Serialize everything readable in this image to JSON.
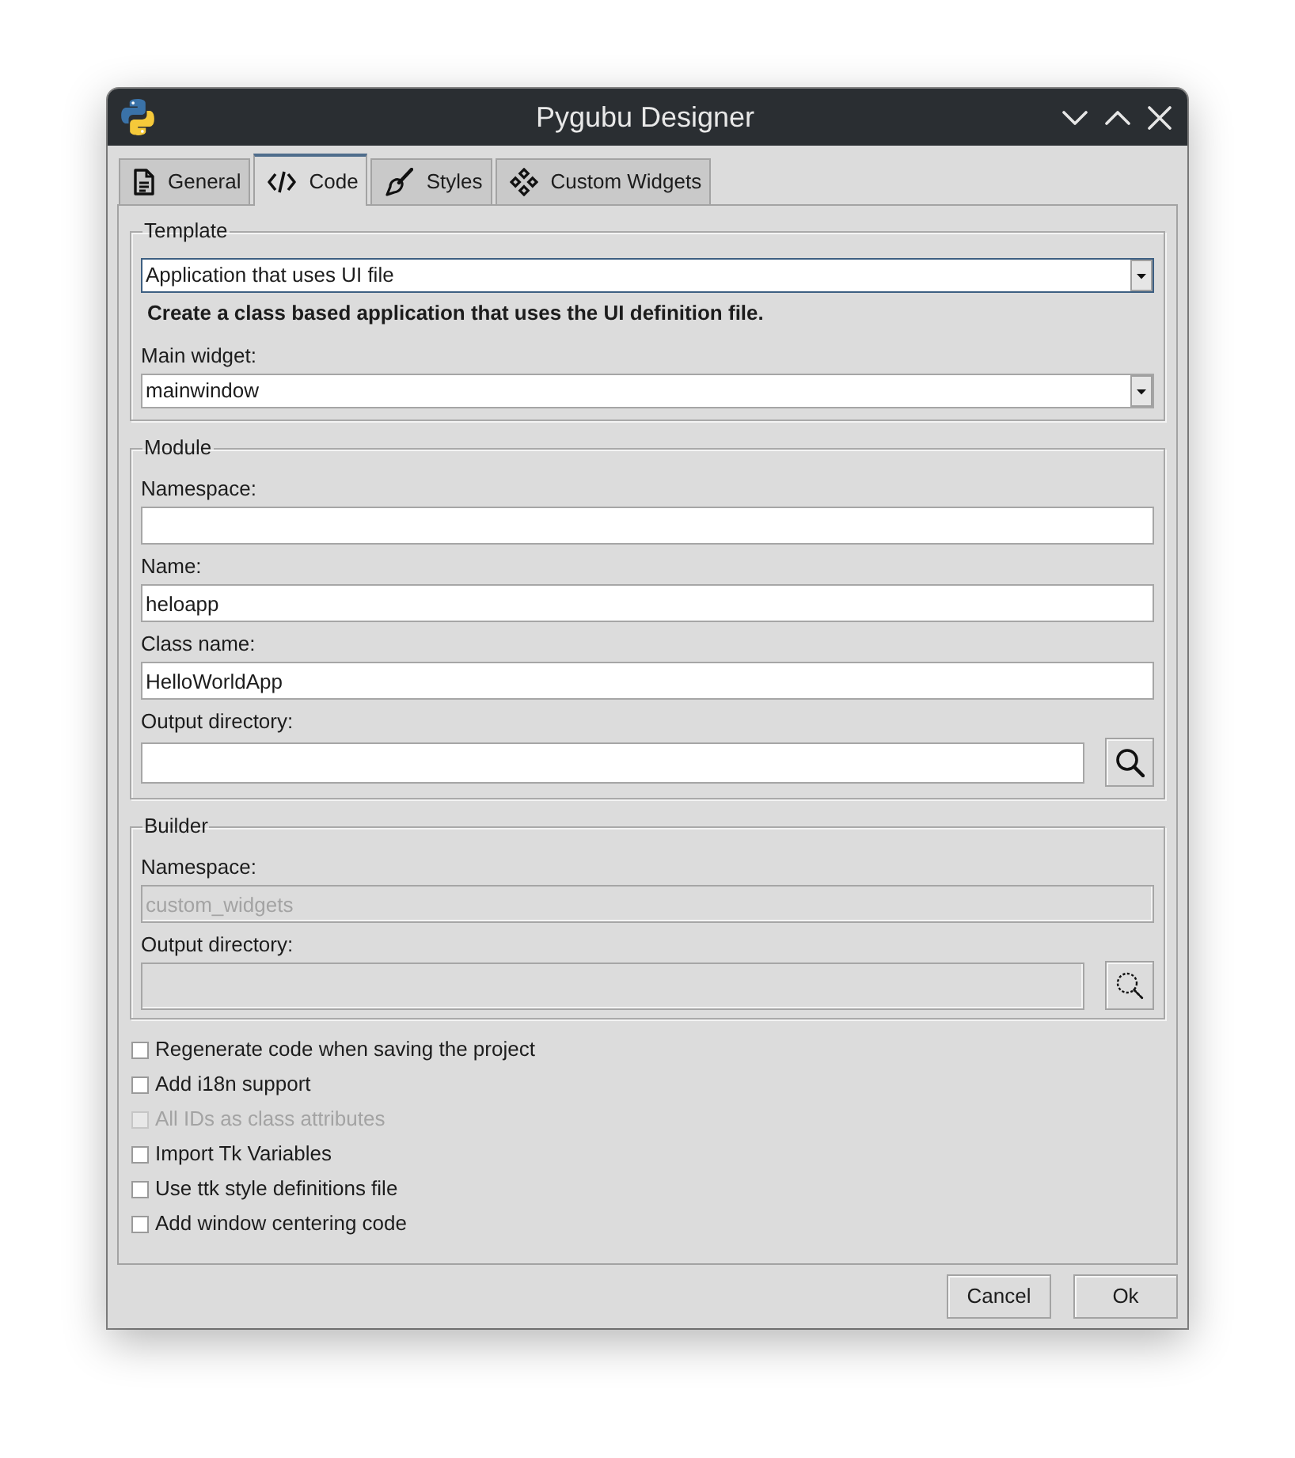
{
  "window": {
    "title": "Pygubu Designer"
  },
  "tabs": [
    {
      "label": "General",
      "selected": false
    },
    {
      "label": "Code",
      "selected": true
    },
    {
      "label": "Styles",
      "selected": false
    },
    {
      "label": "Custom Widgets",
      "selected": false
    }
  ],
  "template": {
    "title": "Template",
    "template_select": {
      "value": "Application that uses UI file",
      "focused": true
    },
    "description": "Create a class based application that uses the UI definition file.",
    "main_widget": {
      "label": "Main widget:",
      "value": "mainwindow",
      "focused": false
    }
  },
  "module": {
    "title": "Module",
    "fields": [
      {
        "kind": "entry",
        "label": "Namespace:",
        "disabled": false
      },
      {
        "kind": "entry",
        "label": "Name:",
        "value": "heloapp",
        "disabled": false
      },
      {
        "kind": "entry",
        "label": "Class name:",
        "value": "HelloWorldApp",
        "disabled": false
      },
      {
        "kind": "path",
        "label": "Output directory:",
        "disabled": false
      }
    ]
  },
  "builder": {
    "title": "Builder",
    "fields": [
      {
        "kind": "entry",
        "label": "Namespace:",
        "value": "custom_widgets",
        "disabled": true
      },
      {
        "kind": "path",
        "label": "Output directory:",
        "disabled": true
      }
    ]
  },
  "options": [
    {
      "label": "Regenerate code when saving the project",
      "checked": false,
      "disabled": false
    },
    {
      "label": "Add i18n support",
      "checked": false,
      "disabled": false
    },
    {
      "label": "All IDs as class attributes",
      "checked": false,
      "disabled": true
    },
    {
      "label": "Import Tk Variables",
      "checked": false,
      "disabled": false
    },
    {
      "label": "Use ttk style definitions file",
      "checked": false,
      "disabled": false
    },
    {
      "label": "Add window centering code",
      "checked": false,
      "disabled": false
    }
  ],
  "buttons": [
    "Cancel",
    "Ok"
  ]
}
